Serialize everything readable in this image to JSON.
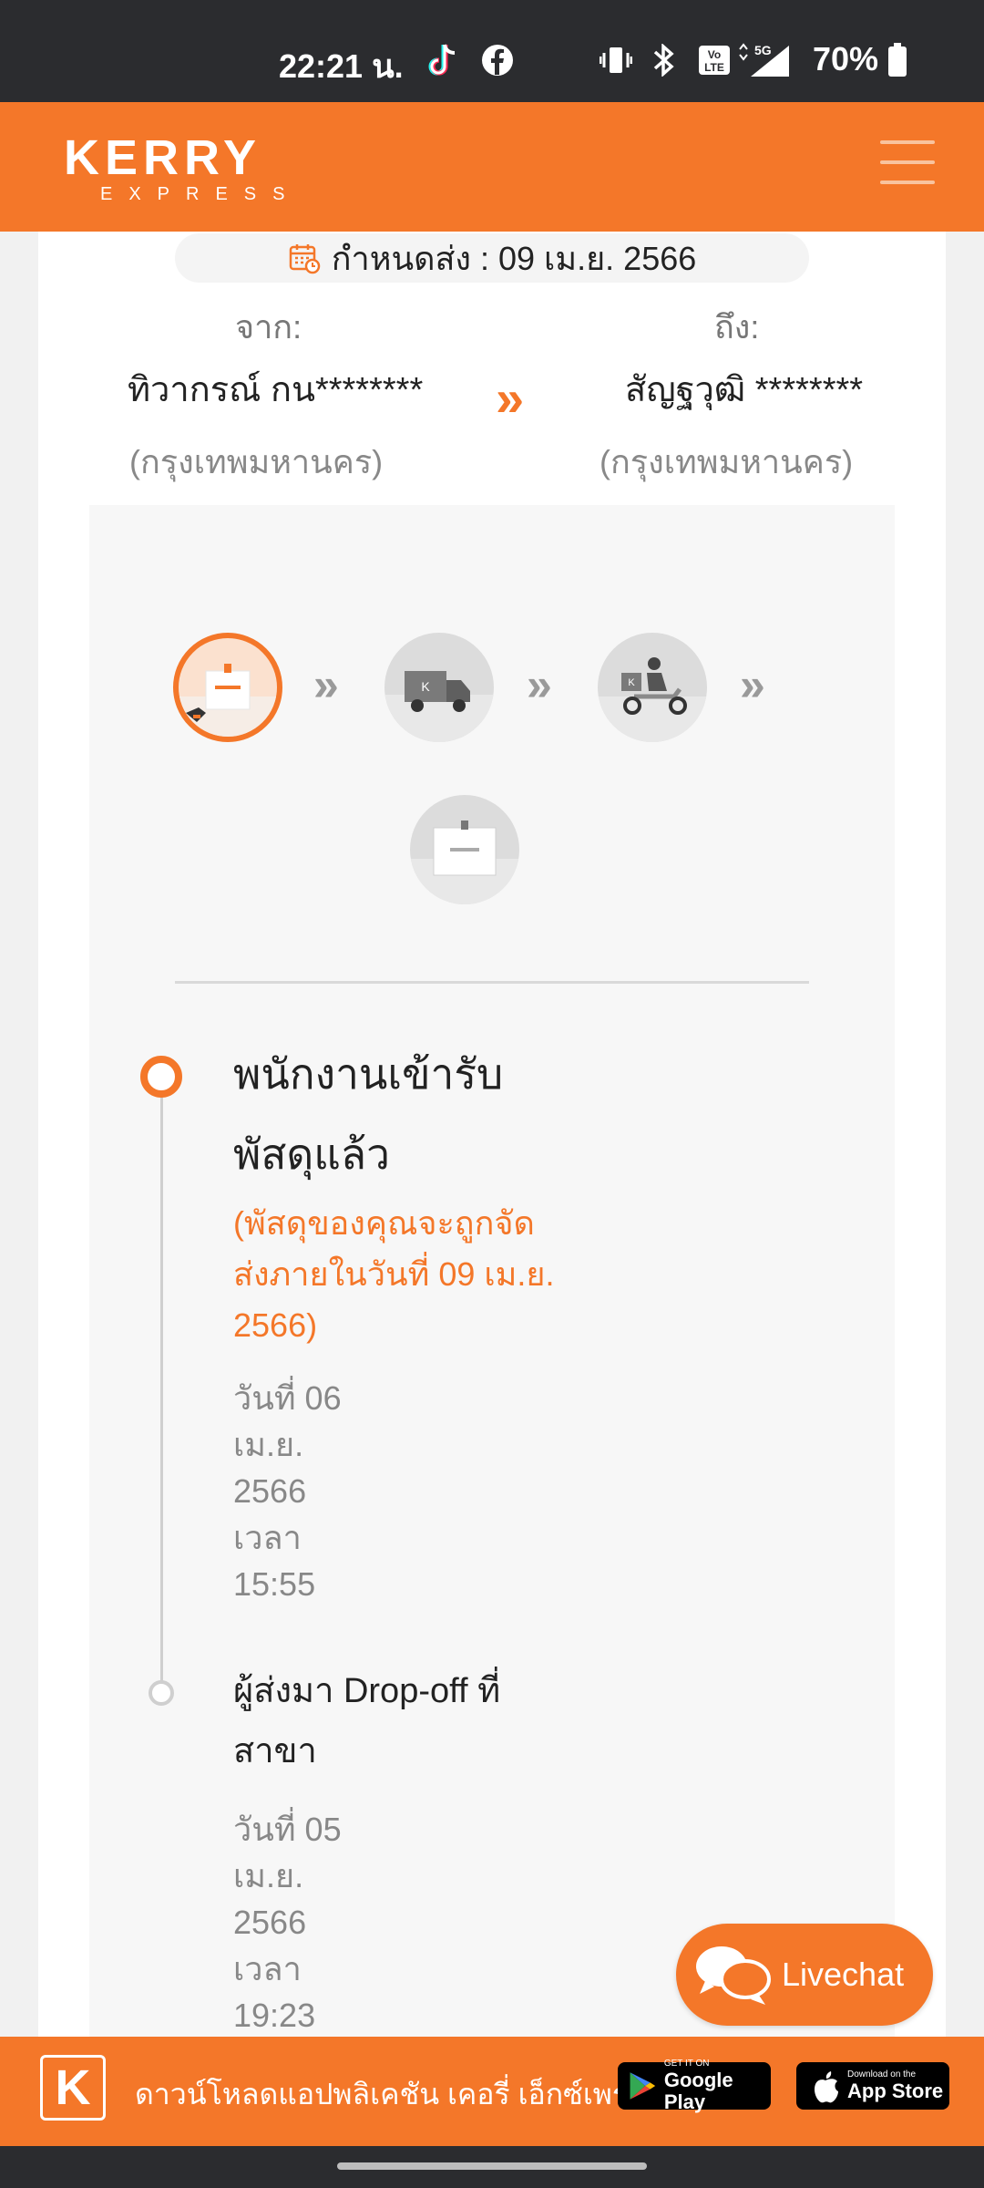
{
  "status_bar": {
    "time": "22:21 น.",
    "battery": "70%",
    "icons": [
      "tiktok-icon",
      "facebook-icon",
      "vibrate-icon",
      "bluetooth-icon",
      "volte-icon",
      "signal-5g-icon",
      "battery-icon"
    ]
  },
  "header": {
    "logo_main": "KERRY",
    "logo_sub": "EXPRESS",
    "menu_icon": "hamburger-menu-icon"
  },
  "shipment": {
    "deadline": "กำหนดส่ง : 09 เม.ย. 2566",
    "from_label": "จาก:",
    "from_name": "ทิวากรณ์ กน********",
    "from_city": "(กรุงเทพมหานคร)",
    "to_label": "ถึง:",
    "to_name": "สัญฐวุฒิ ********",
    "to_city": "(กรุงเทพมหานคร)",
    "route_arrow": "»"
  },
  "steps": {
    "arrow": "»",
    "items": [
      "parcel-pickup",
      "truck-transit",
      "motorbike-delivery",
      "parcel-delivered"
    ]
  },
  "timeline": [
    {
      "title": "พนักงานเข้ารับพัสดุแล้ว",
      "note": "(พัสดุของคุณจะถูกจัดส่งภายในวันที่ 09 เม.ย. 2566)",
      "date": "วันที่ 06 เม.ย. 2566 เวลา 15:55"
    },
    {
      "title": "ผู้ส่งมา Drop-off ที่สาขา",
      "date": "วันที่ 05 เม.ย. 2566 เวลา 19:23"
    }
  ],
  "livechat": {
    "label": "Livechat"
  },
  "app_banner": {
    "text": "ดาวน์โหลดแอปพลิเคชัน เคอรี่ เอ็กซ์เพรส",
    "google_small": "GET IT ON",
    "google_big": "Google Play",
    "apple_small": "Download on the",
    "apple_big": "App Store",
    "k_logo": "K"
  },
  "colors": {
    "brand": "#f47729",
    "status_bar": "#2b2c2f"
  }
}
